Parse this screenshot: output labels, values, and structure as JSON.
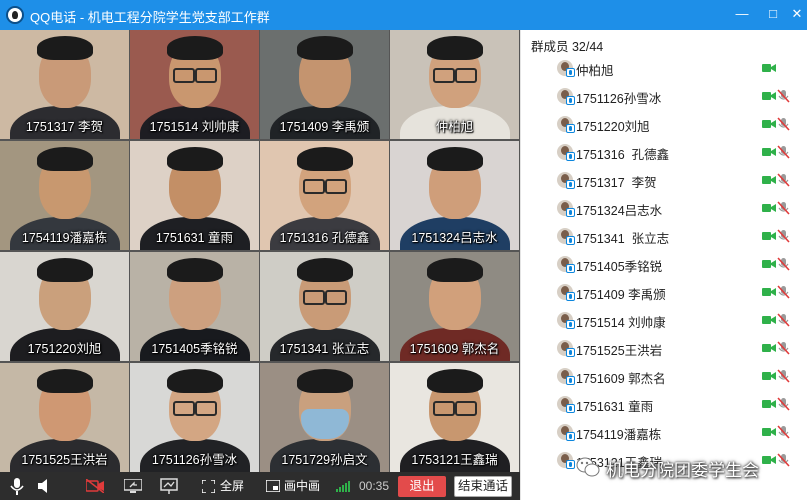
{
  "window": {
    "title": "QQ电话 - 机电工程分院学生党支部工作群",
    "minimize": "—",
    "maximize": "□",
    "close": "✕"
  },
  "grid": {
    "tiles": [
      {
        "name": "1751317 李贺",
        "bg": "#cdb9a3",
        "skin": "#c99a78",
        "shirt": "#2c2c30",
        "glasses": false,
        "mask": false
      },
      {
        "name": "1751514 刘帅康",
        "bg": "#9a5a4f",
        "skin": "#c9976f",
        "shirt": "#1d1d22",
        "glasses": true,
        "mask": false
      },
      {
        "name": "1751409 李禹颁",
        "bg": "#6b6f6e",
        "skin": "#c4946f",
        "shirt": "#202326",
        "glasses": false,
        "mask": false
      },
      {
        "name": "仲柏旭",
        "bg": "#c9c2b8",
        "skin": "#d0a17d",
        "shirt": "#e6e3dc",
        "glasses": true,
        "mask": false
      },
      {
        "name": "1754119潘嘉栋",
        "bg": "#a39680",
        "skin": "#c8986f",
        "shirt": "#34383e",
        "glasses": false,
        "mask": false
      },
      {
        "name": "1751631 童雨",
        "bg": "#ddd1c6",
        "skin": "#c38f66",
        "shirt": "#1e1f23",
        "glasses": false,
        "mask": false
      },
      {
        "name": "1751316 孔德鑫",
        "bg": "#e0c6b0",
        "skin": "#d2a37d",
        "shirt": "#3b3b40",
        "glasses": true,
        "mask": false
      },
      {
        "name": "1751324吕志水",
        "bg": "#d9d4d2",
        "skin": "#cf9e7a",
        "shirt": "#1f3e63",
        "glasses": false,
        "mask": false
      },
      {
        "name": "1751220刘旭",
        "bg": "#d9d6d0",
        "skin": "#caa07c",
        "shirt": "#1d1d20",
        "glasses": false,
        "mask": false
      },
      {
        "name": "1751405季铭锐",
        "bg": "#b9b2a6",
        "skin": "#cda07f",
        "shirt": "#181a1e",
        "glasses": false,
        "mask": false
      },
      {
        "name": "1751341 张立志",
        "bg": "#cfcdc6",
        "skin": "#c99b77",
        "shirt": "#26282b",
        "glasses": true,
        "mask": false
      },
      {
        "name": "1751609 郭杰名",
        "bg": "#8f8b83",
        "skin": "#d1a07b",
        "shirt": "#6f2a25",
        "glasses": false,
        "mask": false
      },
      {
        "name": "1751525王洪岩",
        "bg": "#c5b8a6",
        "skin": "#cf9873",
        "shirt": "#2b2b2e",
        "glasses": false,
        "mask": false
      },
      {
        "name": "1751126孙雪冰",
        "bg": "#d8d8d6",
        "skin": "#d3a683",
        "shirt": "#212225",
        "glasses": true,
        "mask": false
      },
      {
        "name": "1751729孙启文",
        "bg": "#9b8f84",
        "skin": "#c9a07e",
        "shirt": "#2c2f33",
        "glasses": false,
        "mask": true
      },
      {
        "name": "1753121王鑫瑞",
        "bg": "#e9e6e0",
        "skin": "#c8976f",
        "shirt": "#1f1f22",
        "glasses": true,
        "mask": false
      }
    ]
  },
  "toolbar": {
    "fullscreen_label": "全屏",
    "pip_label": "画中画",
    "timer": "00:35",
    "exit_label": "退出",
    "end_call_label": "结束通话"
  },
  "panel": {
    "title": "群成员 32/44",
    "members": [
      {
        "name": "仲柏旭",
        "video": true,
        "mic_muted": false
      },
      {
        "name": "1751126孙雪冰",
        "video": true,
        "mic_muted": true
      },
      {
        "name": "1751220刘旭",
        "video": true,
        "mic_muted": true
      },
      {
        "name": "1751316  孔德鑫",
        "video": true,
        "mic_muted": true
      },
      {
        "name": "1751317  李贺",
        "video": true,
        "mic_muted": true
      },
      {
        "name": "1751324吕志水",
        "video": true,
        "mic_muted": true
      },
      {
        "name": "1751341  张立志",
        "video": true,
        "mic_muted": true
      },
      {
        "name": "1751405季铭锐",
        "video": true,
        "mic_muted": true
      },
      {
        "name": "1751409 李禹颁",
        "video": true,
        "mic_muted": true
      },
      {
        "name": "1751514 刘帅康",
        "video": true,
        "mic_muted": true
      },
      {
        "name": "1751525王洪岩",
        "video": true,
        "mic_muted": true
      },
      {
        "name": "1751609 郭杰名",
        "video": true,
        "mic_muted": true
      },
      {
        "name": "1751631 童雨",
        "video": true,
        "mic_muted": true
      },
      {
        "name": "1754119潘嘉栋",
        "video": true,
        "mic_muted": true
      },
      {
        "name": "1753121王鑫瑞",
        "video": true,
        "mic_muted": true
      }
    ]
  },
  "watermark": {
    "text": "机电分院团委学生会"
  },
  "colors": {
    "titlebar": "#1e8fe8",
    "video_on": "#2fb14a",
    "mic_off": "#e03b3b",
    "exit_button": "#e34b4b"
  },
  "icons": [
    "qq-logo-icon",
    "minimize-icon",
    "maximize-icon",
    "close-icon",
    "microphone-icon",
    "speaker-icon",
    "camera-off-icon",
    "screen-share-icon",
    "whiteboard-icon",
    "fullscreen-icon",
    "pip-icon",
    "signal-icon",
    "video-camera-icon",
    "mic-muted-icon",
    "wechat-logo-icon"
  ]
}
